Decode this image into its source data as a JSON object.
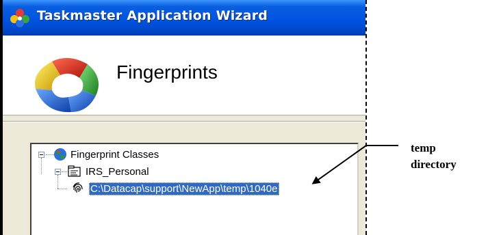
{
  "window": {
    "title": "Taskmaster Application Wizard"
  },
  "header": {
    "title": "Fingerprints"
  },
  "tree": {
    "root": {
      "label": "Fingerprint Classes",
      "icon": "globe-icon"
    },
    "child": {
      "label": "IRS_Personal",
      "icon": "form-icon"
    },
    "leaf": {
      "label": "C:\\Datacap\\support\\NewApp\\temp\\1040e",
      "icon": "fingerprint-icon",
      "selected": true
    }
  },
  "annotation": {
    "line1": "temp",
    "line2": "directory"
  },
  "colors": {
    "titlebar": "#0054e3",
    "selection": "#316ac5",
    "dialog_bg": "#ece9d8"
  }
}
